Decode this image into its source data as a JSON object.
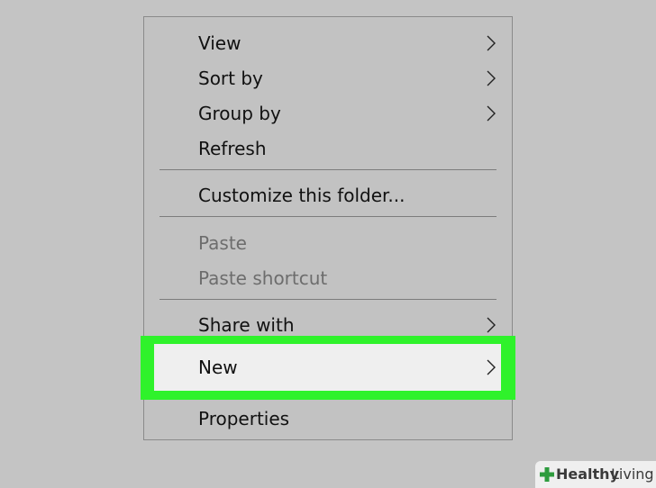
{
  "menu": {
    "items": [
      {
        "label": "View",
        "submenu": true
      },
      {
        "label": "Sort by",
        "submenu": true
      },
      {
        "label": "Group by",
        "submenu": true
      },
      {
        "label": "Refresh",
        "submenu": false
      },
      {
        "label": "Customize this folder...",
        "submenu": false
      },
      {
        "label": "Paste",
        "submenu": false,
        "disabled": true
      },
      {
        "label": "Paste shortcut",
        "submenu": false,
        "disabled": true
      },
      {
        "label": "Share with",
        "submenu": true
      },
      {
        "label": "New",
        "submenu": true,
        "highlighted": true
      },
      {
        "label": "Properties",
        "submenu": false
      }
    ]
  },
  "colors": {
    "highlight_border": "#2ff22b",
    "highlight_fill": "#efefef",
    "menu_background": "#c2c2c2"
  },
  "brand": {
    "part1": "Healthy",
    "part2": "Living",
    "icon": "plus-leaf-icon"
  }
}
